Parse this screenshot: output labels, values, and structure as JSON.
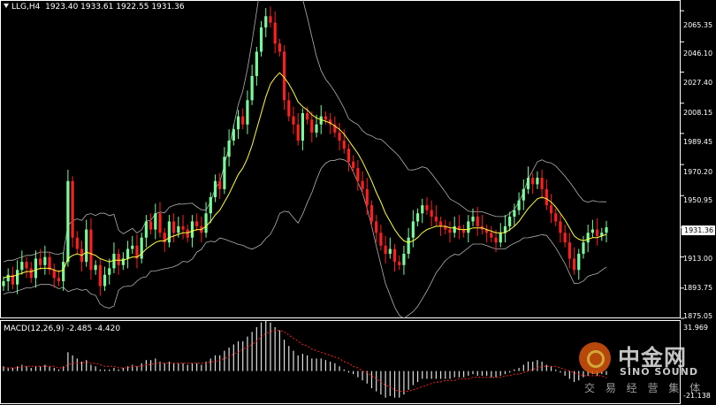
{
  "header": {
    "symbol_info": "LLG,H4",
    "ohlc": "1923.40 1933.61 1922.55 1931.36"
  },
  "price_axis": {
    "labels": [
      "2065.35",
      "2046.10",
      "2027.40",
      "2008.15",
      "1989.45",
      "1970.20",
      "1950.95",
      "1931.36",
      "1913.00",
      "1893.75",
      "1875.05"
    ],
    "current_price": "1931.36"
  },
  "macd": {
    "label": "MACD(12,26,9) -2.485 -4.420",
    "axis_top": "31.969",
    "axis_bottom": "-21.138"
  },
  "watermark": {
    "cn": "中金网",
    "en": "SINO SOUND",
    "sub": "交 易 经 营 集 体"
  },
  "colors": {
    "background": "#000000",
    "bull_candle": "#7CFC9A",
    "bear_candle": "#FF2020",
    "ma_line": "#FFFF40",
    "bollinger": "#B0B0B0",
    "macd_hist": "#E0E0E0",
    "macd_signal": "#FF2020"
  },
  "chart_data": {
    "type": "candlestick",
    "ylim": [
      1875.05,
      2072
    ],
    "close": [
      1898,
      1902,
      1896,
      1905,
      1910,
      1906,
      1900,
      1912,
      1908,
      1913,
      1905,
      1900,
      1898,
      1910,
      1960,
      1925,
      1918,
      1910,
      1930,
      1905,
      1908,
      1895,
      1902,
      1906,
      1915,
      1908,
      1912,
      1918,
      1920,
      1912,
      1925,
      1935,
      1930,
      1940,
      1928,
      1922,
      1935,
      1928,
      1932,
      1930,
      1925,
      1935,
      1932,
      1928,
      1940,
      1950,
      1960,
      1955,
      1975,
      1985,
      1992,
      2000,
      1995,
      2010,
      2025,
      2040,
      2055,
      2062,
      2058,
      2045,
      2040,
      2010,
      2000,
      1995,
      1985,
      2002,
      1998,
      1990,
      1995,
      2000,
      1998,
      1995,
      1990,
      1985,
      1980,
      1972,
      1968,
      1960,
      1955,
      1945,
      1935,
      1928,
      1920,
      1915,
      1918,
      1910,
      1908,
      1915,
      1925,
      1935,
      1940,
      1945,
      1942,
      1938,
      1935,
      1932,
      1930,
      1928,
      1932,
      1930,
      1928,
      1935,
      1938,
      1932,
      1930,
      1928,
      1925,
      1922,
      1928,
      1932,
      1938,
      1942,
      1948,
      1955,
      1962,
      1958,
      1962,
      1955,
      1945,
      1940,
      1935,
      1928,
      1922,
      1912,
      1905,
      1915,
      1922,
      1928,
      1930,
      1926,
      1928,
      1931.36
    ],
    "ma": [
      1900,
      1901,
      1901,
      1902,
      1903,
      1904,
      1904,
      1905,
      1906,
      1906,
      1906,
      1905,
      1904,
      1905,
      1912,
      1914,
      1915,
      1914,
      1916,
      1915,
      1914,
      1912,
      1911,
      1910,
      1911,
      1911,
      1911,
      1912,
      1913,
      1913,
      1915,
      1918,
      1920,
      1922,
      1923,
      1923,
      1925,
      1926,
      1927,
      1928,
      1928,
      1929,
      1930,
      1930,
      1932,
      1935,
      1939,
      1942,
      1947,
      1952,
      1958,
      1964,
      1968,
      1974,
      1982,
      1992,
      2002,
      2012,
      2020,
      2024,
      2027,
      2024,
      2020,
      2015,
      2009,
      2006,
      2004,
      2001,
      1999,
      1998,
      1997,
      1996,
      1994,
      1992,
      1989,
      1985,
      1981,
      1977,
      1972,
      1966,
      1960,
      1953,
      1947,
      1940,
      1935,
      1930,
      1926,
      1923,
      1922,
      1923,
      1925,
      1928,
      1930,
      1931,
      1932,
      1932,
      1932,
      1931,
      1931,
      1930,
      1930,
      1930,
      1931,
      1931,
      1931,
      1930,
      1929,
      1928,
      1928,
      1928,
      1930,
      1932,
      1935,
      1939,
      1943,
      1946,
      1949,
      1950,
      1949,
      1947,
      1944,
      1940,
      1936,
      1931,
      1926,
      1924,
      1923,
      1924,
      1925,
      1925,
      1926,
      1927
    ],
    "macd_hist": [
      3,
      2,
      2,
      3,
      4,
      3,
      2,
      3,
      3,
      4,
      3,
      2,
      1,
      3,
      12,
      10,
      8,
      6,
      7,
      4,
      3,
      1,
      1,
      1,
      2,
      1,
      2,
      3,
      4,
      3,
      5,
      7,
      7,
      8,
      6,
      5,
      6,
      5,
      5,
      5,
      4,
      5,
      5,
      4,
      6,
      8,
      10,
      10,
      13,
      15,
      17,
      19,
      19,
      22,
      25,
      28,
      31,
      32,
      31,
      28,
      26,
      20,
      16,
      13,
      10,
      11,
      10,
      8,
      8,
      8,
      7,
      6,
      5,
      3,
      1,
      -1,
      -2,
      -4,
      -6,
      -8,
      -11,
      -13,
      -15,
      -17,
      -16,
      -17,
      -17,
      -15,
      -12,
      -9,
      -7,
      -5,
      -5,
      -5,
      -5,
      -5,
      -5,
      -5,
      -4,
      -4,
      -4,
      -3,
      -2,
      -3,
      -3,
      -3,
      -4,
      -4,
      -3,
      -2,
      -1,
      1,
      2,
      4,
      6,
      6,
      7,
      6,
      4,
      3,
      1,
      -1,
      -3,
      -5,
      -7,
      -6,
      -4,
      -3,
      -2,
      -3,
      -2,
      -2.485
    ],
    "macd_signal": [
      2,
      2,
      2,
      2,
      3,
      3,
      3,
      3,
      3,
      3,
      3,
      3,
      2,
      2,
      4,
      5,
      5,
      5,
      6,
      5,
      5,
      4,
      3,
      3,
      3,
      2,
      2,
      2,
      3,
      3,
      3,
      4,
      4,
      5,
      5,
      5,
      5,
      5,
      5,
      5,
      5,
      5,
      5,
      5,
      5,
      6,
      6,
      7,
      8,
      9,
      11,
      12,
      14,
      15,
      17,
      19,
      22,
      24,
      25,
      26,
      26,
      25,
      23,
      21,
      19,
      17,
      16,
      14,
      13,
      12,
      11,
      10,
      9,
      8,
      6,
      5,
      3,
      2,
      0,
      -1,
      -3,
      -5,
      -7,
      -9,
      -10,
      -12,
      -13,
      -13,
      -13,
      -12,
      -11,
      -10,
      -9,
      -8,
      -7,
      -7,
      -6,
      -6,
      -6,
      -5,
      -5,
      -5,
      -4,
      -4,
      -4,
      -4,
      -4,
      -4,
      -4,
      -3,
      -3,
      -2,
      -2,
      -1,
      0,
      1,
      2,
      3,
      3,
      3,
      3,
      2,
      1,
      0,
      -1,
      -2,
      -3,
      -3,
      -3,
      -3,
      -3,
      -4.42
    ],
    "macd_ylim": [
      -21.138,
      31.969
    ]
  }
}
